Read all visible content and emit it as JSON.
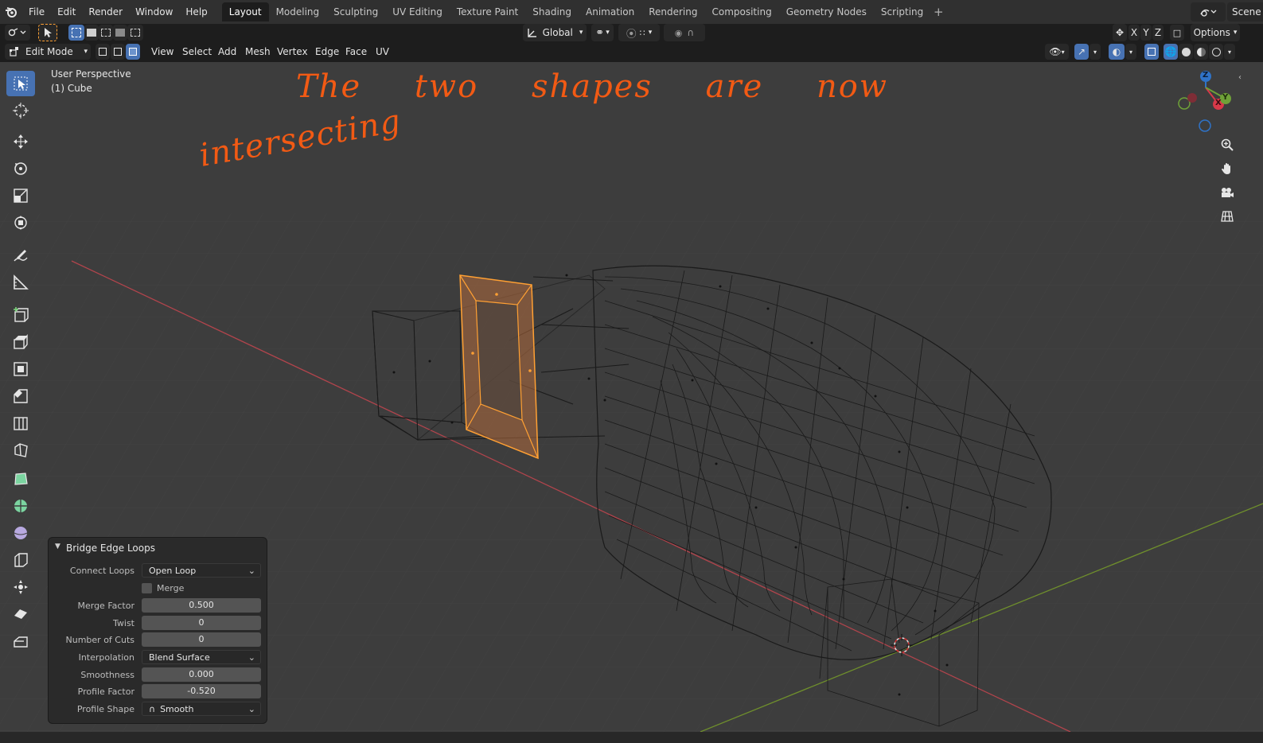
{
  "menus": [
    "File",
    "Edit",
    "Render",
    "Window",
    "Help"
  ],
  "workspace_tabs": [
    "Layout",
    "Modeling",
    "Sculpting",
    "UV Editing",
    "Texture Paint",
    "Shading",
    "Animation",
    "Rendering",
    "Compositing",
    "Geometry Nodes",
    "Scripting"
  ],
  "scene_label": "Scene",
  "tool_header": {
    "transform_orientation": "Global",
    "axis_x": "X",
    "axis_y": "Y",
    "axis_z": "Z",
    "options_label": "Options"
  },
  "edit_header": {
    "mode": "Edit Mode",
    "menus": [
      "View",
      "Select",
      "Add",
      "Mesh",
      "Vertex",
      "Edge",
      "Face",
      "UV"
    ]
  },
  "viewport": {
    "perspective": "User Perspective",
    "object": "(1) Cube",
    "annotation_line1": "The two shapes are now",
    "annotation_line2": "intersecting",
    "gizmo_x": "X",
    "gizmo_y": "Y",
    "gizmo_z": "Z"
  },
  "operator_panel": {
    "title": "Bridge Edge Loops",
    "connect_loops_label": "Connect Loops",
    "connect_loops_value": "Open Loop",
    "merge_label": "Merge",
    "merge_checked": false,
    "merge_factor_label": "Merge Factor",
    "merge_factor_value": "0.500",
    "twist_label": "Twist",
    "twist_value": "0",
    "cuts_label": "Number of Cuts",
    "cuts_value": "0",
    "interpolation_label": "Interpolation",
    "interpolation_value": "Blend Surface",
    "smoothness_label": "Smoothness",
    "smoothness_value": "0.000",
    "profile_factor_label": "Profile Factor",
    "profile_factor_value": "-0.520",
    "profile_shape_label": "Profile Shape",
    "profile_shape_value": "Smooth"
  },
  "colors": {
    "accent": "#4772b3",
    "annotation": "#f25a14",
    "selection": "#ffa033",
    "viewport_bg": "#3d3d3d"
  }
}
